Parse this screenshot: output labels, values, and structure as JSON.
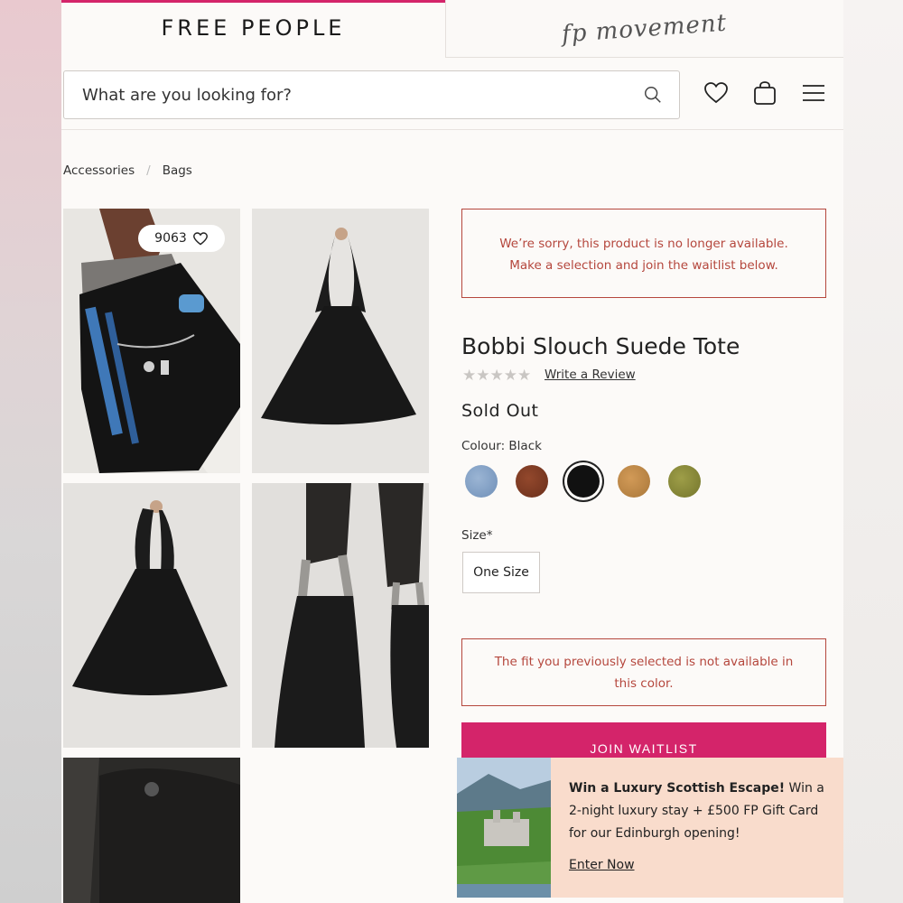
{
  "header": {
    "brand": "FREE PEOPLE",
    "movement_logo": "fp movement",
    "accent_color": "#d4246a"
  },
  "search": {
    "placeholder": "What are you looking for?",
    "icon": "search-icon"
  },
  "header_icons": [
    "heart-icon",
    "bag-icon",
    "menu-icon"
  ],
  "breadcrumb": {
    "items": [
      "Accessories",
      "Bags"
    ],
    "separator": "/"
  },
  "gallery": {
    "like_count": "9063"
  },
  "notices": {
    "unavailable_line1": "We’re sorry, this product is no longer available.",
    "unavailable_line2": "Make a selection and join the waitlist below.",
    "fit_line1": "The fit you previously selected is not available in",
    "fit_line2": "this color.",
    "color": "#b5473d"
  },
  "product": {
    "title": "Bobbi Slouch Suede Tote",
    "rating_stars": "★★★★★",
    "rating_value": 0,
    "write_review": "Write a Review",
    "status": "Sold Out",
    "colour_label": "Colour: Black",
    "swatches": [
      {
        "name": "blue",
        "color": "#7f9ec4"
      },
      {
        "name": "brown",
        "color": "#7a3a24"
      },
      {
        "name": "black",
        "color": "#111111",
        "selected": true
      },
      {
        "name": "tan",
        "color": "#c08a48"
      },
      {
        "name": "olive",
        "color": "#8a8a3a"
      }
    ],
    "size_label": "Size*",
    "size_option": "One Size",
    "cta": "JOIN WAITLIST"
  },
  "promo": {
    "headline": "Win a Luxury Scottish Escape!",
    "body": " Win a 2-night luxury stay + £500 FP Gift Card for our Edinburgh opening!",
    "link": "Enter Now",
    "bg_color": "#f9dccc"
  }
}
